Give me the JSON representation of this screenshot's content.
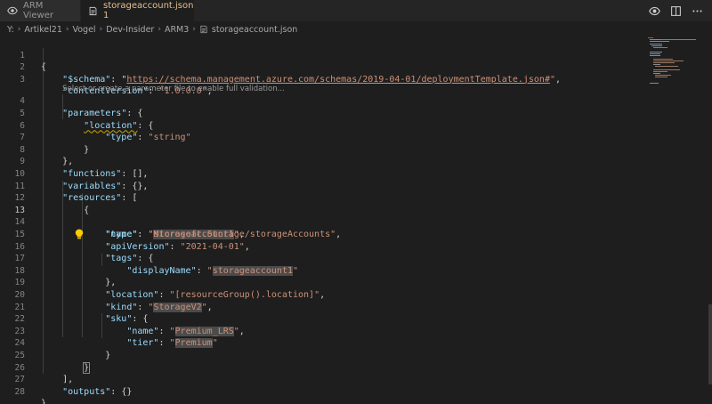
{
  "tabs": [
    {
      "label": "ARM Viewer"
    },
    {
      "label": "storageaccount.json 1"
    }
  ],
  "breadcrumb": {
    "segments": [
      "Y:",
      "Artikel21",
      "Vogel",
      "Dev-Insider",
      "ARM3",
      "storageaccount.json"
    ]
  },
  "editor": {
    "code_lens": "Select or create a parameter file to enable full validation...",
    "current_line": 13,
    "lines": [
      {
        "n": "1"
      },
      {
        "n": "2"
      },
      {
        "n": "3"
      },
      {
        "n": "4"
      },
      {
        "n": "5"
      },
      {
        "n": "6"
      },
      {
        "n": "7"
      },
      {
        "n": "8"
      },
      {
        "n": "9"
      },
      {
        "n": "10"
      },
      {
        "n": "11"
      },
      {
        "n": "12"
      },
      {
        "n": "13"
      },
      {
        "n": "14"
      },
      {
        "n": "15"
      },
      {
        "n": "16"
      },
      {
        "n": "17"
      },
      {
        "n": "18"
      },
      {
        "n": "19"
      },
      {
        "n": "20"
      },
      {
        "n": "21"
      },
      {
        "n": "22"
      },
      {
        "n": "23"
      },
      {
        "n": "24"
      },
      {
        "n": "25"
      },
      {
        "n": "26"
      },
      {
        "n": "27"
      },
      {
        "n": "28"
      }
    ],
    "tokens": {
      "schema_key": "\"$schema\"",
      "schema_url": "https://schema.management.azure.com/schemas/2019-04-01/deploymentTemplate.json#",
      "contentVersion_key": "\"contentVersion\"",
      "contentVersion_val": "\"1.0.0.0\"",
      "parameters_key": "\"parameters\"",
      "location_key": "\"location\"",
      "type_key": "\"type\"",
      "string_val": "\"string\"",
      "functions_key": "\"functions\"",
      "variables_key": "\"variables\"",
      "resources_key": "\"resources\"",
      "name_key": "\"name\"",
      "storageaccount_name": "storageaccount1",
      "type_val": "\"Microsoft.Storage/storageAccounts\"",
      "apiVersion_key": "\"apiVersion\"",
      "apiVersion_val": "\"2021-04-01\"",
      "tags_key": "\"tags\"",
      "displayName_key": "\"displayName\"",
      "location_val": "\"[resourceGroup().location]\"",
      "kind_key": "\"kind\"",
      "kind_val": "StorageV2",
      "sku_key": "\"sku\"",
      "sku_name_val": "Premium_LRS",
      "tier_key": "\"tier\"",
      "tier_val": "Premium",
      "outputs_key": "\"outputs\""
    }
  },
  "colors": {
    "key": "#9cdcfe",
    "string": "#ce9178",
    "punctuation": "#d4d4d4",
    "modified_tab": "#e2c08d",
    "warning": "#cca700"
  }
}
